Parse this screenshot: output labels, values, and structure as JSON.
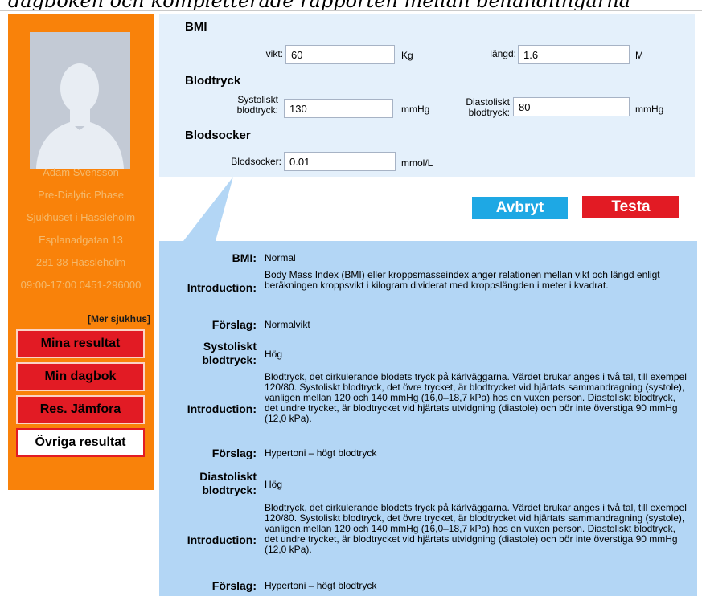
{
  "header_fragment": "dagboken och kompletterade rapporten mellan behandlingarna",
  "sidebar": {
    "patient_name": "Adam Svensson",
    "phase": "Pre-Dialytic Phase",
    "hospital": "Sjukhuset i Hässleholm",
    "street": "Esplanadgatan 13",
    "postal": "281 38  Hässleholm",
    "hours_phone": "09:00-17:00  0451-296000",
    "more_link": "[Mer sjukhus]",
    "nav": [
      {
        "label": "Mina resultat"
      },
      {
        "label": "Min dagbok"
      },
      {
        "label": "Res. Jämfora"
      },
      {
        "label": "Övriga resultat"
      }
    ]
  },
  "form": {
    "bmi": {
      "title": "BMI",
      "weight_label": "vikt:",
      "weight_value": "60",
      "weight_unit": "Kg",
      "height_label": "längd:",
      "height_value": "1.6",
      "height_unit": "M"
    },
    "bp": {
      "title": "Blodtryck",
      "sys_label_1": "Systoliskt",
      "sys_label_2": "blodtryck:",
      "sys_value": "130",
      "sys_unit": "mmHg",
      "dia_label_1": "Diastoliskt",
      "dia_label_2": "blodtryck:",
      "dia_value": "80",
      "dia_unit": "mmHg"
    },
    "sugar": {
      "title": "Blodsocker",
      "label": "Blodsocker:",
      "value": "0.01",
      "unit": "mmol/L"
    }
  },
  "actions": {
    "cancel": "Avbryt",
    "test": "Testa"
  },
  "results": {
    "bmi_label": "BMI:",
    "bmi_value": "Normal",
    "intro_label": "Introduction:",
    "bmi_intro": "Body Mass Index (BMI) eller kroppsmasseindex anger relationen mellan vikt och längd enligt beräkningen kroppsvikt i kilogram dividerat med kroppslängden i meter i kvadrat.",
    "suggest_label": "Förslag:",
    "bmi_suggest": "Normalvikt",
    "sys_label_1": "Systoliskt",
    "sys_label_2": "blodtryck:",
    "sys_value": "Hög",
    "bp_intro": "Blodtryck, det cirkulerande blodets tryck på kärlväggarna. Värdet brukar anges i två tal, till exempel 120/80. Systoliskt blodtryck, det övre trycket, är blodtrycket vid hjärtats sammandragning (systole), vanligen mellan 120 och 140 mmHg (16,0–18,7 kPa) hos en vuxen person. Diastoliskt blodtryck, det undre trycket, är blodtrycket vid hjärtats utvidgning (diastole) och bör inte överstiga 90 mmHg (12,0 kPa).",
    "sys_suggest": "Hypertoni – högt blodtryck",
    "dia_label_1": "Diastoliskt",
    "dia_label_2": "blodtryck:",
    "dia_value": "Hög",
    "dia_suggest": "Hypertoni – högt blodtryck"
  },
  "colors": {
    "sidebar_bg": "#f9820a",
    "nav_red": "#e21b24",
    "cancel_blue": "#1ea8e4",
    "form_bg": "#e4f0fb",
    "results_bg": "#b3d6f5"
  }
}
